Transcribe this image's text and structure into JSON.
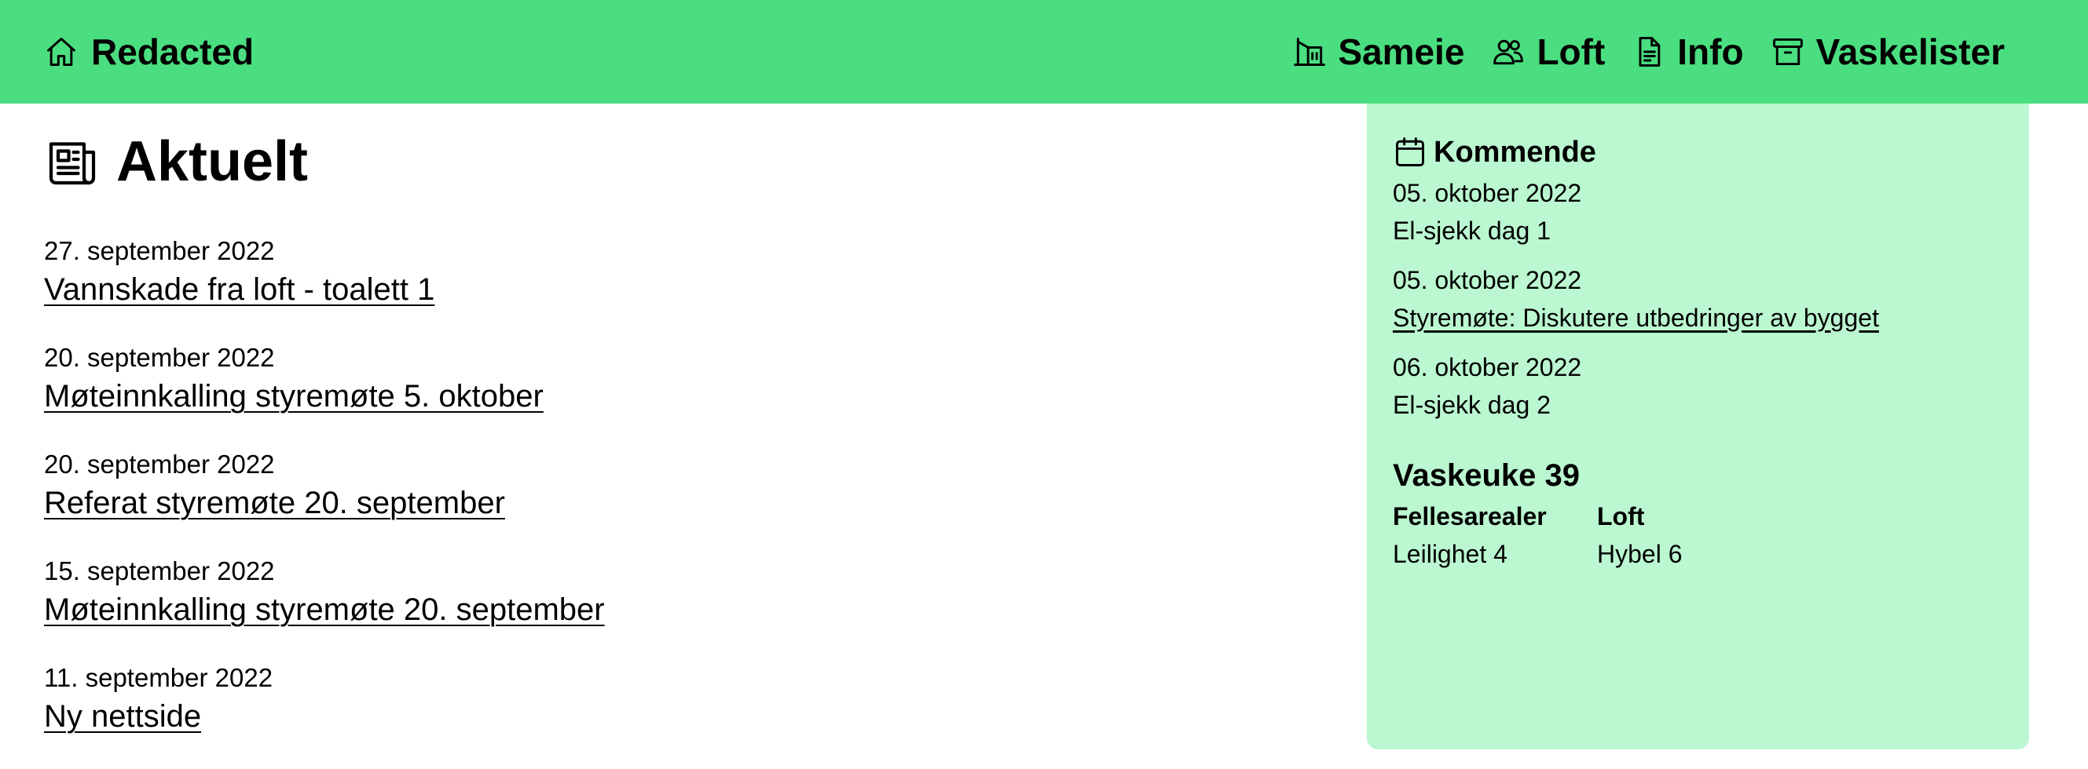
{
  "header": {
    "brand": "Redacted",
    "nav": [
      "Sameie",
      "Loft",
      "Info",
      "Vaskelister"
    ]
  },
  "main": {
    "title": "Aktuelt",
    "news": [
      {
        "date": "27. september 2022",
        "title": "Vannskade fra loft - toalett 1"
      },
      {
        "date": "20. september 2022",
        "title": "Møteinnkalling styremøte 5. oktober"
      },
      {
        "date": "20. september 2022",
        "title": "Referat styremøte 20. september"
      },
      {
        "date": "15. september 2022",
        "title": "Møteinnkalling styremøte 20. september"
      },
      {
        "date": "11. september 2022",
        "title": "Ny nettside"
      }
    ]
  },
  "sidebar": {
    "upcoming_title": "Kommende",
    "events": [
      {
        "date": "05. oktober 2022",
        "title": "El-sjekk dag 1"
      },
      {
        "date": "05. oktober 2022",
        "title": "Styremøte: Diskutere utbedringer av bygget"
      },
      {
        "date": "06. oktober 2022",
        "title": "El-sjekk dag 2"
      }
    ],
    "wash": {
      "title": "Vaskeuke 39",
      "columns": [
        "Fellesarealer",
        "Loft"
      ],
      "values": [
        "Leilighet 4",
        "Hybel 6"
      ]
    }
  },
  "icons": {
    "brand": "home-icon",
    "nav": [
      "building-icon",
      "users-icon",
      "document-icon",
      "archive-icon"
    ],
    "title": "newspaper-icon",
    "upcoming": "calendar-icon"
  },
  "colors": {
    "header_bg": "#4ade80",
    "sidebar_bg": "#bbf7d0",
    "text": "#000000"
  }
}
